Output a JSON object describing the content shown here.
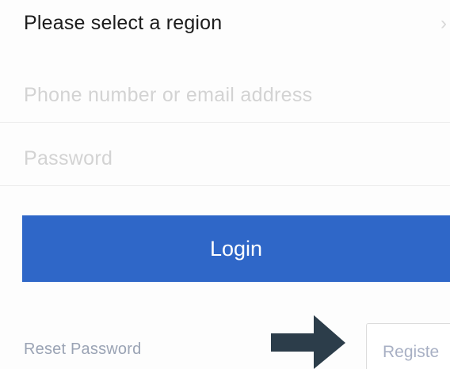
{
  "region": {
    "label": "Please select a region",
    "chevron": "›"
  },
  "login_form": {
    "phone_placeholder": "Phone number or email address",
    "password_placeholder": "Password",
    "login_label": "Login"
  },
  "footer": {
    "reset_password_label": "Reset Password",
    "register_label": "Registe"
  },
  "colors": {
    "accent": "#2f67c8",
    "placeholder": "#d3d3d3",
    "link": "#9aa3b4",
    "arrow": "#2c3d4a"
  },
  "icons": {
    "chevron": "chevron-right-icon",
    "arrow": "arrow-right-icon"
  }
}
